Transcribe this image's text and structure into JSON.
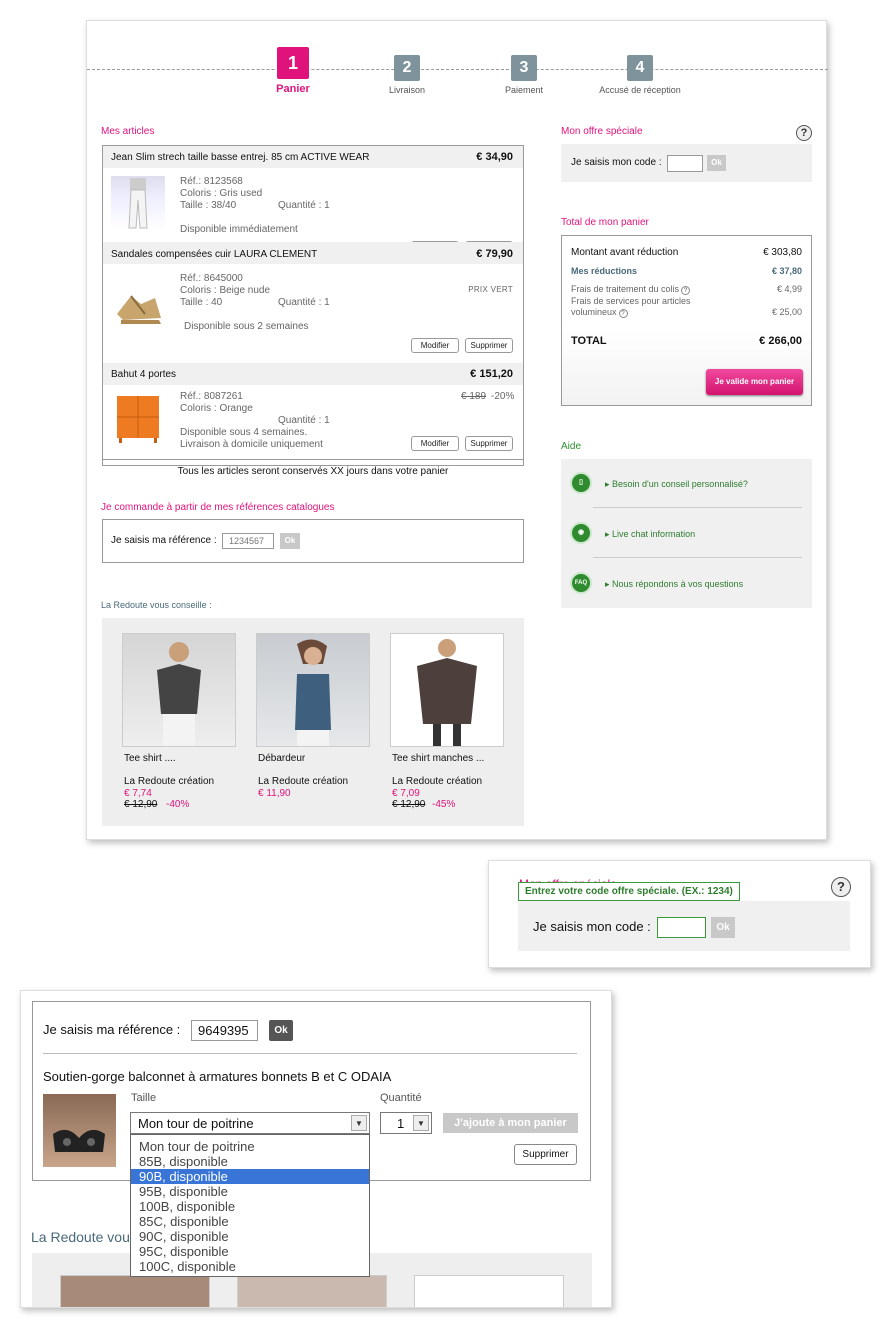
{
  "steps": [
    {
      "num": "1",
      "label": "Panier"
    },
    {
      "num": "2",
      "label": "Livraison"
    },
    {
      "num": "3",
      "label": "Paiement"
    },
    {
      "num": "4",
      "label": "Accusé de réception"
    }
  ],
  "articles": {
    "title": "Mes articles",
    "items": [
      {
        "name": "Jean Slim strech taille basse entrej. 85 cm ACTIVE WEAR",
        "price": "€ 34,90",
        "ref": "Réf.: 8123568",
        "color": "Coloris : Gris used",
        "size": "Taille : 38/40",
        "qty": "Quantité : 1",
        "avail": "Disponible immédiatement",
        "extra": "",
        "old_price": "",
        "discount": ""
      },
      {
        "name": "Sandales compensées cuir LAURA CLEMENT",
        "price": "€ 79,90",
        "ref": "Réf.: 8645000",
        "color": "Coloris : Beige nude",
        "size": "Taille : 40",
        "qty": "Quantité : 1",
        "avail": "Disponible sous 2 semaines",
        "extra": "PRIX VERT",
        "old_price": "",
        "discount": ""
      },
      {
        "name": "Bahut 4 portes",
        "price": "€ 151,20",
        "ref": "Réf.: 8087261",
        "color": "Coloris : Orange",
        "size": "",
        "qty": "Quantité : 1",
        "avail": "Disponible sous 4 semaines.",
        "avail2": "Livraison à domicile uniquement",
        "extra": "",
        "old_price": "€ 189",
        "discount": "-20%"
      }
    ],
    "modify_label": "Modifier",
    "delete_label": "Supprimer",
    "footer": "Tous les articles seront conservés XX jours dans votre panier"
  },
  "catalogue": {
    "title": "Je commande à partir de mes références catalogues",
    "label": "Je saisis ma référence :",
    "placeholder": "1234567",
    "ok": "Ok"
  },
  "conseille": {
    "title": "La Redoute vous conseille :",
    "products": [
      {
        "name": "Tee shirt ....",
        "brand": "La Redoute création",
        "price": "€ 7,74",
        "old": "€ 12,90",
        "disc": "-40%"
      },
      {
        "name": "Débardeur",
        "brand": "La Redoute création",
        "price": "€ 11,90",
        "old": "",
        "disc": ""
      },
      {
        "name": "Tee shirt manches ...",
        "brand": "La Redoute création",
        "price": "€ 7,09",
        "old": "€ 12,90",
        "disc": "-45%"
      }
    ]
  },
  "offre": {
    "title": "Mon offre spéciale",
    "help": "?",
    "label": "Je saisis mon code :",
    "ok": "Ok"
  },
  "total": {
    "title": "Total de mon panier",
    "avant_label": "Montant avant réduction",
    "avant_value": "€ 303,80",
    "reduc_label": "Mes réductions",
    "reduc_value": "€ 37,80",
    "frais_label": "Frais de traitement du colis",
    "frais_value": "€ 4,99",
    "services_label1": "Frais de services pour articles",
    "services_label2": "volumineux",
    "services_value": "€ 25,00",
    "total_label": "TOTAL",
    "total_value": "€ 266,00",
    "validate": "Je valide mon panier"
  },
  "aide": {
    "title": "Aide",
    "items": [
      {
        "icon": "phone-icon",
        "glyph": "▯",
        "label": "Besoin d'un conseil personnalisé?"
      },
      {
        "icon": "chat-icon",
        "glyph": "◉",
        "label": "Live chat information"
      },
      {
        "icon": "faq-icon",
        "glyph": "FAQ",
        "label": "Nous répondons à vos questions"
      }
    ]
  },
  "zoom_offre": {
    "title": "Mon offre spéciale",
    "tooltip": "Entrez votre code offre spéciale. (EX.: 1234)",
    "help": "?",
    "label": "Je saisis mon code :",
    "ok": "Ok"
  },
  "zoom_ref": {
    "label": "Je saisis ma référence :",
    "value": "9649395",
    "ok": "Ok",
    "product": "Soutien-gorge balconnet à armatures bonnets B et C ODAIA",
    "taille_label": "Taille",
    "quantite_label": "Quantité",
    "select_value": "Mon tour de poitrine",
    "qty_value": "1",
    "add": "J'ajoute à mon panier",
    "delete": "Supprimer",
    "options": [
      "Mon tour de poitrine",
      "85B, disponible",
      "90B, disponible",
      "95B, disponible",
      "100B, disponible",
      "85C, disponible",
      "90C, disponible",
      "95C, disponible",
      "100C, disponible"
    ],
    "selected_option": "90B, disponible",
    "conseille_title": "La Redoute vous conseille"
  },
  "colors": {
    "pink": "#e0137d",
    "step_gray": "#7f939c",
    "panel_bg": "#f0f0f0"
  }
}
